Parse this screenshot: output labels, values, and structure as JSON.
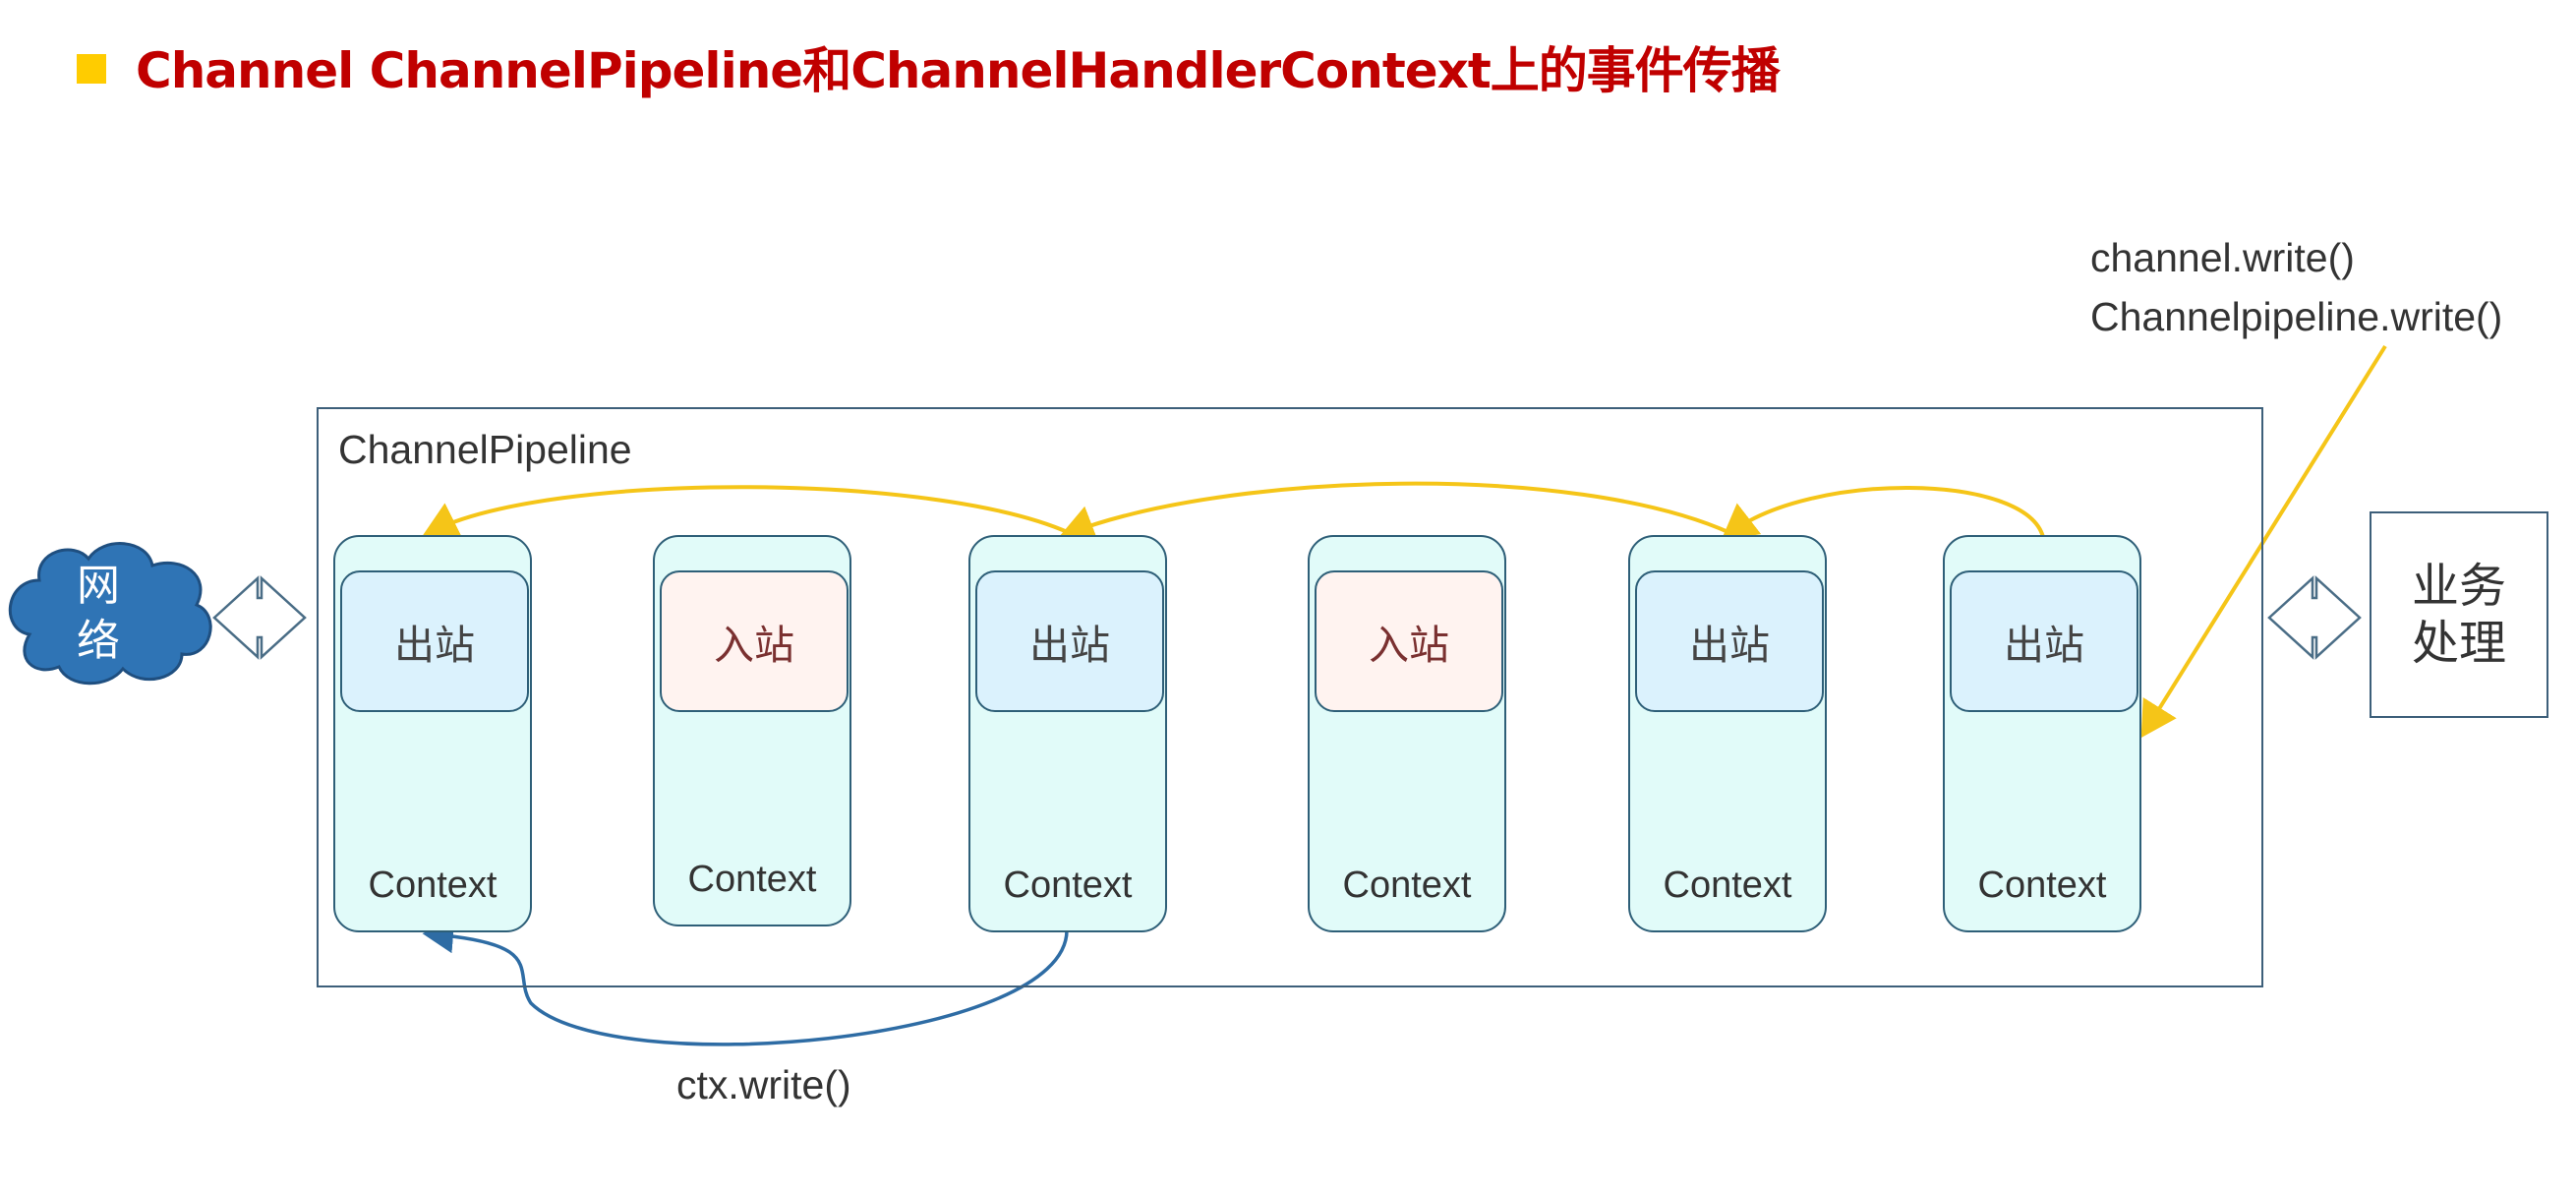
{
  "title": "Channel ChannelPipeline和ChannelHandlerContext上的事件传播",
  "pipeline_label": "ChannelPipeline",
  "network_label": {
    "line1": "网",
    "line2": "络"
  },
  "business_label": {
    "line1": "业务",
    "line2": "处理"
  },
  "contexts": [
    {
      "handler": "出站",
      "type": "out",
      "label": "Context"
    },
    {
      "handler": "入站",
      "type": "in",
      "label": "Context"
    },
    {
      "handler": "出站",
      "type": "out",
      "label": "Context"
    },
    {
      "handler": "入站",
      "type": "in",
      "label": "Context"
    },
    {
      "handler": "出站",
      "type": "out",
      "label": "Context"
    },
    {
      "handler": "出站",
      "type": "out",
      "label": "Context"
    }
  ],
  "callout": {
    "line1": "channel.write()",
    "line2": "Channelpipeline.write()"
  },
  "ctx_write_label": "ctx.write()",
  "colors": {
    "title": "#c00000",
    "bullet": "#ffcc00",
    "pipeline_arrow": "#f5c518",
    "ctx_arrow": "#2e6ca4",
    "cloud": "#2f74b5",
    "outbound_fill": "#dbf2fd",
    "inbound_fill": "#fff3f0",
    "context_fill": "#e1fbf9"
  }
}
